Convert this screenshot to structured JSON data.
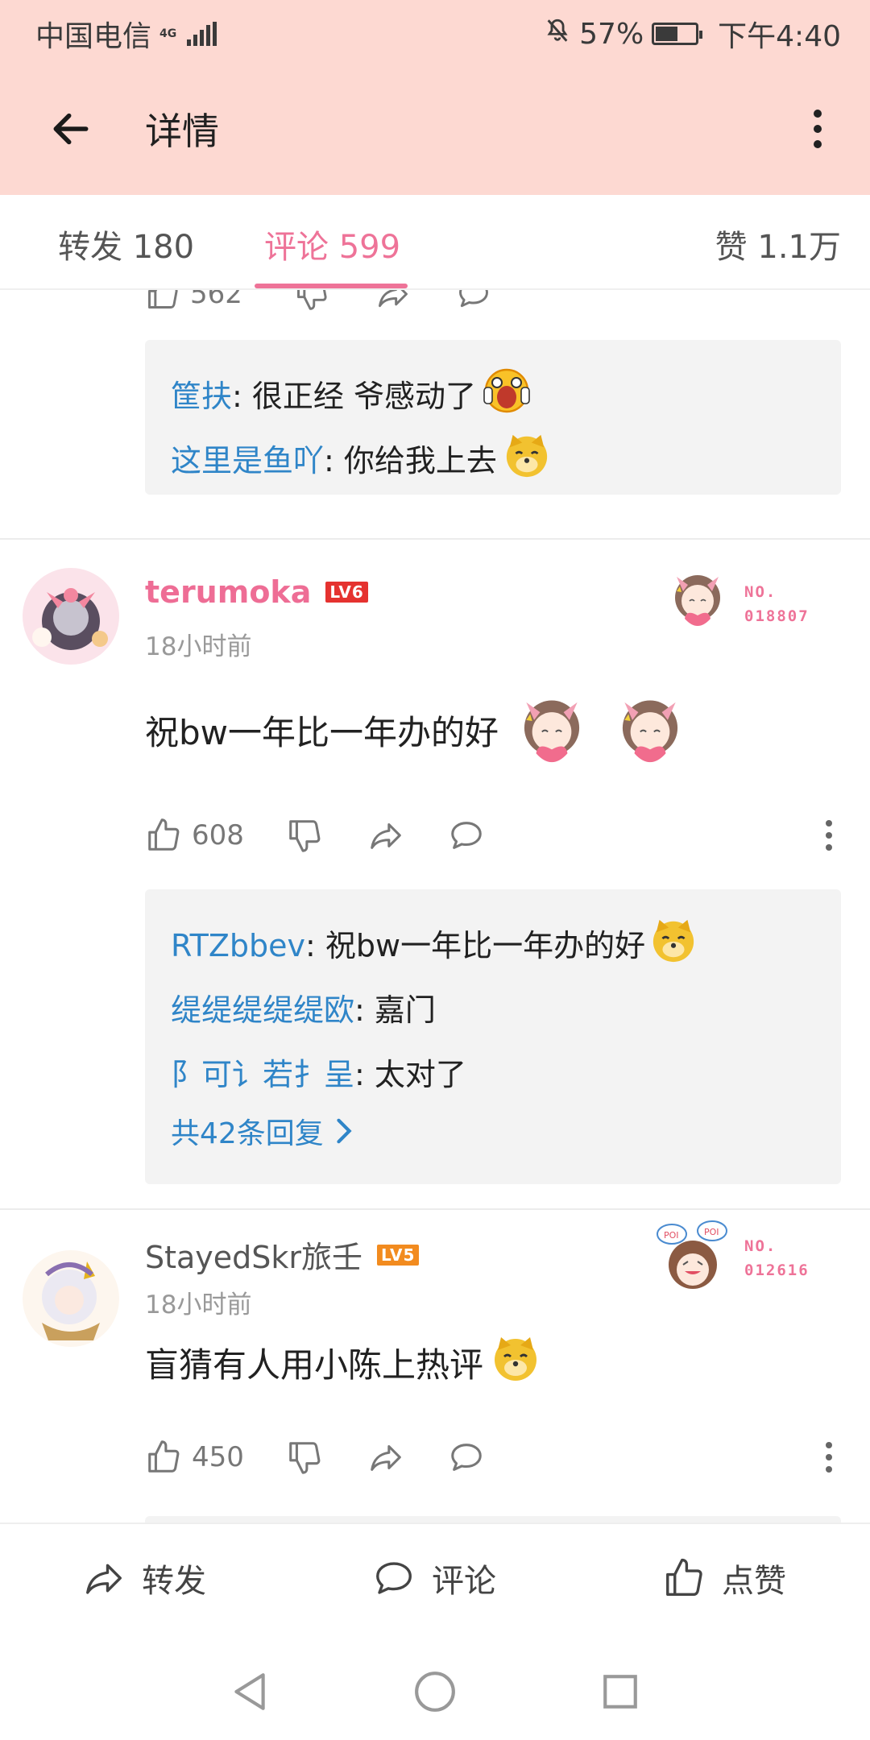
{
  "status_bar": {
    "carrier": "中国电信",
    "network": "4G",
    "battery": "57%",
    "battery_level": 0.57,
    "time": "下午4:40"
  },
  "app_bar": {
    "title": "详情",
    "back_icon": "arrow-left-icon",
    "menu_icon": "more-vertical-icon"
  },
  "tabs": [
    {
      "label": "转发 180",
      "active": false
    },
    {
      "label": "评论 599",
      "active": true
    },
    {
      "label": "赞 1.1万",
      "active": false
    }
  ],
  "top_partial": {
    "like_count": "562"
  },
  "top_replies": [
    {
      "user": "筐扶",
      "text": ": 很正经 爷感动了",
      "emoji": "shocked-face-emoji"
    },
    {
      "user": "这里是鱼吖",
      "text": ": 你给我上去",
      "emoji": "doge-emoji"
    }
  ],
  "comments": [
    {
      "username": "terumoka",
      "level": "LV6",
      "time": "18小时前",
      "badge_no": "NO.",
      "badge_number": "018807",
      "text": "祝bw一年比一年办的好",
      "like_count": "608",
      "replies": [
        {
          "user": "RTZbbev",
          "text": ": 祝bw一年比一年办的好"
        },
        {
          "user": "缇缇缇缇缇欧",
          "text": ": 嘉门"
        },
        {
          "user": "阝可讠若扌呈",
          "text": ": 太对了"
        }
      ],
      "reply_more": "共42条回复"
    },
    {
      "username": "StayedSkr旅壬",
      "level": "LV5",
      "time": "18小时前",
      "badge_no": "NO.",
      "badge_number": "012616",
      "badge_tag": "POI",
      "text": "盲猜有人用小陈上热评",
      "like_count": "450"
    }
  ],
  "bottom_bar": [
    {
      "label": "转发",
      "icon": "share-icon"
    },
    {
      "label": "评论",
      "icon": "comment-icon"
    },
    {
      "label": "点赞",
      "icon": "like-icon"
    }
  ],
  "nav_bar": [
    "back-triangle-icon",
    "home-circle-icon",
    "recents-square-icon"
  ],
  "colors": {
    "header_bg": "#fdd9d2",
    "accent": "#ee7398",
    "link": "#2f85c8",
    "reply_bg": "#f3f3f3"
  }
}
